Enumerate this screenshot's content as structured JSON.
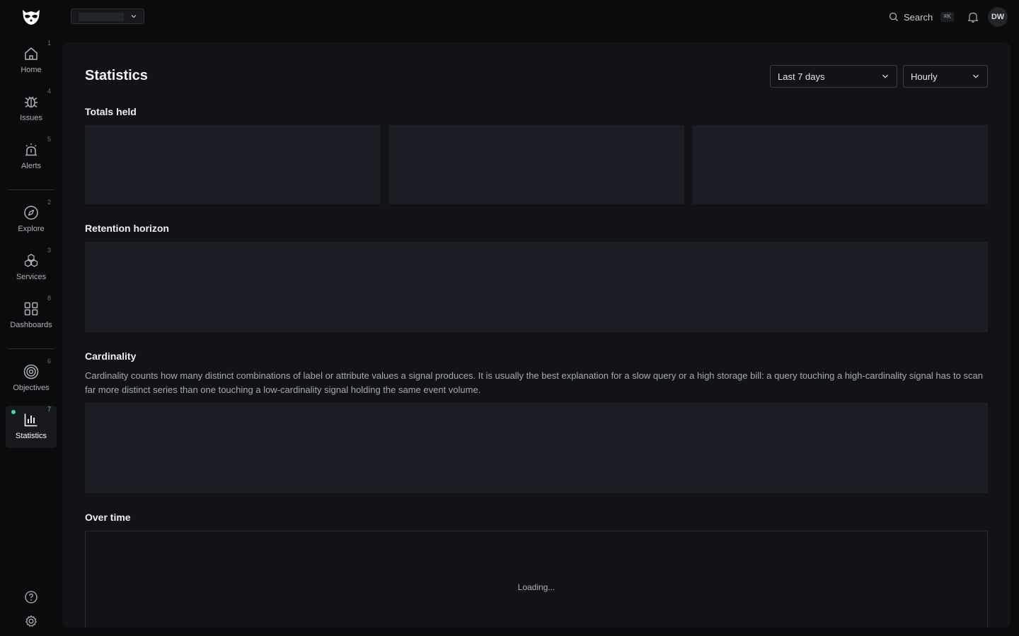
{
  "header": {
    "search_label": "Search",
    "search_shortcut": "⌘K",
    "user_initials": "DW"
  },
  "sidebar": {
    "items": [
      {
        "label": "Home",
        "shortcut": "1",
        "icon": "home-icon"
      },
      {
        "label": "Issues",
        "shortcut": "4",
        "icon": "bug-icon"
      },
      {
        "label": "Alerts",
        "shortcut": "5",
        "icon": "siren-icon"
      },
      {
        "label": "Explore",
        "shortcut": "2",
        "icon": "compass-icon"
      },
      {
        "label": "Services",
        "shortcut": "3",
        "icon": "cubes-icon"
      },
      {
        "label": "Dashboards",
        "shortcut": "8",
        "icon": "grid-icon"
      },
      {
        "label": "Objectives",
        "shortcut": "6",
        "icon": "target-icon"
      },
      {
        "label": "Statistics",
        "shortcut": "7",
        "icon": "bar-chart-icon",
        "active": true
      }
    ],
    "bottom_icons": [
      "help-icon",
      "settings-icon"
    ]
  },
  "page": {
    "title": "Statistics",
    "range_select": "Last 7 days",
    "granularity_select": "Hourly",
    "sections": {
      "totals": "Totals held",
      "retention": "Retention horizon",
      "cardinality": "Cardinality",
      "cardinality_desc": "Cardinality counts how many distinct combinations of label or attribute values a signal produces. It is usually the best explanation for a slow query or a high storage bill: a query touching a high-cardinality signal has to scan far more distinct series than one touching a low-cardinality signal holding the same event volume.",
      "over_time": "Over time",
      "loading": "Loading..."
    }
  },
  "colors": {
    "accent": "#3fd9a6",
    "panel": "#111317",
    "background": "#0a0b0d",
    "skeleton": "#1b1e24"
  }
}
